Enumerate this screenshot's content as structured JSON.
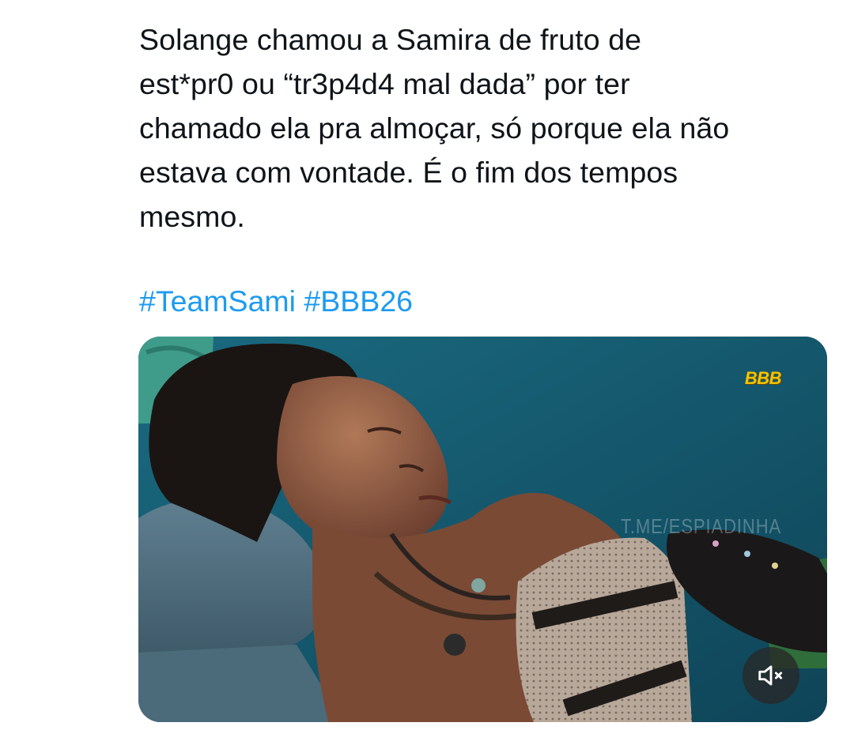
{
  "tweet": {
    "text_lines": [
      "Solange chamou a Samira de fruto de",
      "est*pr0 ou “tr3p4d4 mal dada” por ter",
      "chamado ela pra almoçar, só porque ela não",
      "estava com vontade. É o fim dos tempos",
      "mesmo."
    ],
    "hashtags": [
      "#TeamSami",
      "#BBB26"
    ]
  },
  "media": {
    "overlay_logo": "BBB",
    "watermark": "T.ME/ESPIADINHA",
    "mute_icon": "speaker-muted-icon"
  },
  "colors": {
    "text": "#0f1419",
    "link": "#1d9bf0",
    "background": "#ffffff"
  }
}
